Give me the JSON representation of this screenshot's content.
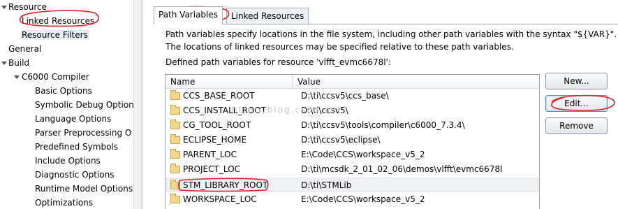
{
  "tree": {
    "items": [
      {
        "label": "Resource",
        "twisty": true,
        "selected": false
      },
      {
        "label": "Linked Resources",
        "twisty": false,
        "selected": false
      },
      {
        "label": "Resource Filters",
        "twisty": false,
        "selected": true
      },
      {
        "label": "General",
        "twisty": false,
        "selected": false
      },
      {
        "label": "Build",
        "twisty": true,
        "selected": false
      },
      {
        "label": "C6000 Compiler",
        "twisty": true,
        "selected": false
      },
      {
        "label": "Basic Options",
        "twisty": false,
        "selected": false
      },
      {
        "label": "Symbolic Debug Option",
        "twisty": false,
        "selected": false
      },
      {
        "label": "Language Options",
        "twisty": false,
        "selected": false
      },
      {
        "label": "Parser Preprocessing O",
        "twisty": false,
        "selected": false
      },
      {
        "label": "Predefined Symbols",
        "twisty": false,
        "selected": false
      },
      {
        "label": "Include Options",
        "twisty": false,
        "selected": false
      },
      {
        "label": "Diagnostic Options",
        "twisty": false,
        "selected": false
      },
      {
        "label": "Runtime Model Options",
        "twisty": false,
        "selected": false
      },
      {
        "label": "Optimizations",
        "twisty": false,
        "selected": false
      }
    ]
  },
  "tabs": [
    {
      "label": "Path Variables",
      "active": true
    },
    {
      "label": "Linked Resources",
      "active": false
    }
  ],
  "description": {
    "line1": "Path variables specify locations in the file system, including other path variables with the syntax \"${VAR}\".",
    "line2": "The locations of linked resources may be specified relative to these path variables.",
    "defined_label": "Defined path variables for resource 'vlfft_evmc6678l':"
  },
  "table": {
    "columns": [
      "Name",
      "Value"
    ],
    "rows": [
      {
        "name": "CCS_BASE_ROOT",
        "value": "D:\\ti\\ccsv5\\ccs_base\\"
      },
      {
        "name": "CCS_INSTALL_ROOT",
        "value": "D:\\ti\\ccsv5\\"
      },
      {
        "name": "CG_TOOL_ROOT",
        "value": "D:\\ti\\ccsv5\\tools\\compiler\\c6000_7.3.4\\"
      },
      {
        "name": "ECLIPSE_HOME",
        "value": "D:\\ti\\ccsv5\\eclipse\\"
      },
      {
        "name": "PARENT_LOC",
        "value": "E:\\Code\\CCS\\workspace_v5_2"
      },
      {
        "name": "PROJECT_LOC",
        "value": "D:\\ti\\mcsdk_2_01_02_06\\demos\\vlfft\\evmc6678l"
      },
      {
        "name": "STM_LIBRARY_ROOT",
        "value": "D:\\ti\\STMLib"
      },
      {
        "name": "WORKSPACE_LOC",
        "value": "E:\\Code\\CCS\\workspace_v5_2"
      }
    ],
    "selected_index": 6
  },
  "buttons": {
    "new_label": "New...",
    "edit_label": "Edit...",
    "remove_label": "Remove"
  },
  "watermark": "http://blog.csdn.net/",
  "colors": {
    "annotation": "#e0202a",
    "folder": "#f3d58c",
    "selection": "#e8eef7"
  }
}
